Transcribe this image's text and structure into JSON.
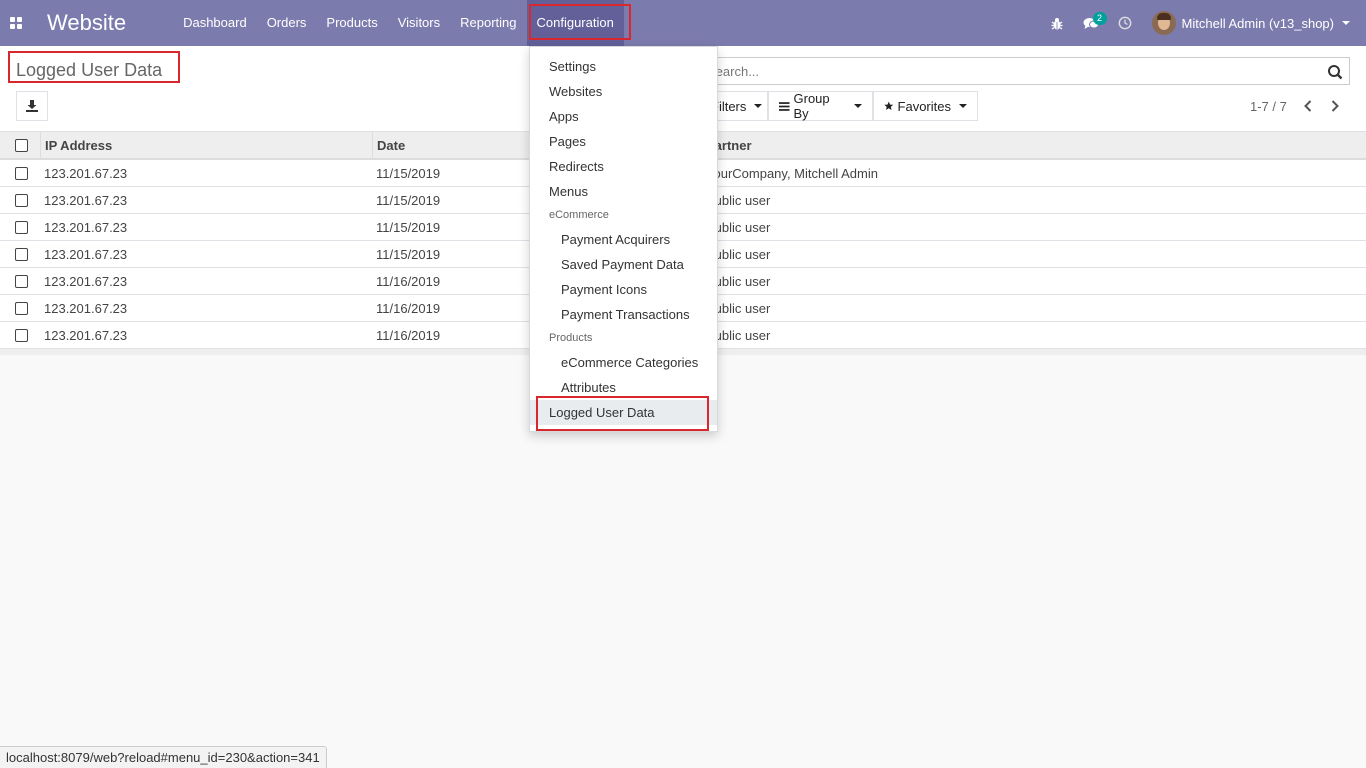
{
  "navbar": {
    "brand": "Website",
    "menu": [
      "Dashboard",
      "Orders",
      "Products",
      "Visitors",
      "Reporting",
      "Configuration"
    ],
    "active_menu": "Configuration",
    "chat_badge": "2",
    "user_label": "Mitchell Admin (v13_shop)",
    "accent_color": "#7c7bad"
  },
  "control_panel": {
    "title": "Logged User Data",
    "search_placeholder": "Search...",
    "filters_label": "Filters",
    "group_by_label": "Group By",
    "favorites_label": "Favorites",
    "pager": "1-7 / 7"
  },
  "list": {
    "columns": [
      "IP Address",
      "Date",
      "Partner"
    ],
    "rows": [
      {
        "ip": "123.201.67.23",
        "date": "11/15/2019",
        "partner": "YourCompany, Mitchell Admin"
      },
      {
        "ip": "123.201.67.23",
        "date": "11/15/2019",
        "partner": "Public user"
      },
      {
        "ip": "123.201.67.23",
        "date": "11/15/2019",
        "partner": "Public user"
      },
      {
        "ip": "123.201.67.23",
        "date": "11/15/2019",
        "partner": "Public user"
      },
      {
        "ip": "123.201.67.23",
        "date": "11/16/2019",
        "partner": "Public user"
      },
      {
        "ip": "123.201.67.23",
        "date": "11/16/2019",
        "partner": "Public user"
      },
      {
        "ip": "123.201.67.23",
        "date": "11/16/2019",
        "partner": "Public user"
      }
    ]
  },
  "dropdown": {
    "items": [
      "Settings",
      "Websites",
      "Apps",
      "Pages",
      "Redirects",
      "Menus"
    ],
    "section_ecommerce": "eCommerce",
    "ecommerce_items": [
      "Payment Acquirers",
      "Saved Payment Data",
      "Payment Icons",
      "Payment Transactions"
    ],
    "section_products": "Products",
    "product_items": [
      "eCommerce Categories",
      "Attributes"
    ],
    "selected_item": "Logged User Data"
  },
  "statusbar": {
    "url": "localhost:8079/web?reload#menu_id=230&action=341"
  },
  "highlight_color": "#d9272e"
}
